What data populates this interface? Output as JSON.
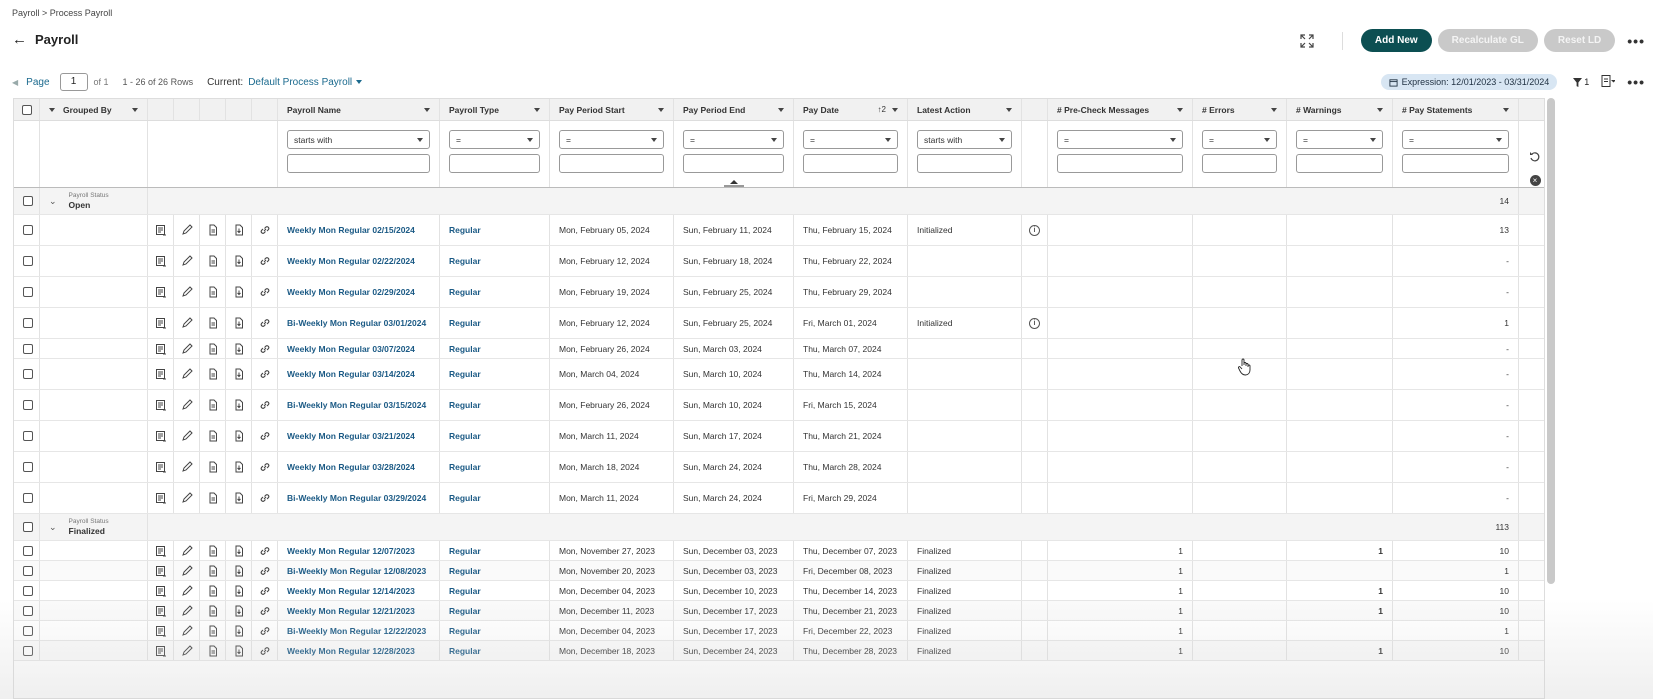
{
  "breadcrumb": "Payroll > Process Payroll",
  "page_title": "Payroll",
  "actions": {
    "add_new": "Add New",
    "recalculate": "Recalculate GL",
    "reset": "Reset LD",
    "more": "•••"
  },
  "pager": {
    "page_label": "Page",
    "page_value": "1",
    "of_text": "of 1",
    "rows_text": "1 - 26 of 26 Rows",
    "current_label": "Current:",
    "current_value": "Default Process Payroll",
    "expression": "Expression: 12/01/2023 - 03/31/2024",
    "filter_count": "1"
  },
  "columns": {
    "grouped_by": "Grouped By",
    "payroll_name": "Payroll Name",
    "payroll_type": "Payroll Type",
    "pay_period_start": "Pay Period Start",
    "pay_period_end": "Pay Period End",
    "pay_date": "Pay Date",
    "pay_date_sort": "2",
    "latest_action": "Latest Action",
    "pre_check": "# Pre-Check Messages",
    "errors": "# Errors",
    "warnings": "# Warnings",
    "pay_statements": "# Pay Statements"
  },
  "filters": {
    "starts_with": "starts with",
    "equals": "="
  },
  "groups": [
    {
      "status_label": "Payroll Status",
      "status": "Open",
      "count": "14",
      "rows": [
        {
          "name": "Weekly Mon Regular 02/15/2024",
          "type": "Regular",
          "start": "Mon, February 05, 2024",
          "end": "Sun, February 11, 2024",
          "paydate": "Thu, February 15, 2024",
          "action": "Initialized",
          "info": "i",
          "pre": "",
          "err": "",
          "warn": "",
          "stmt": "13"
        },
        {
          "name": "Weekly Mon Regular 02/22/2024",
          "type": "Regular",
          "start": "Mon, February 12, 2024",
          "end": "Sun, February 18, 2024",
          "paydate": "Thu, February 22, 2024",
          "action": "",
          "info": "",
          "pre": "",
          "err": "",
          "warn": "",
          "stmt": "-"
        },
        {
          "name": "Weekly Mon Regular 02/29/2024",
          "type": "Regular",
          "start": "Mon, February 19, 2024",
          "end": "Sun, February 25, 2024",
          "paydate": "Thu, February 29, 2024",
          "action": "",
          "info": "",
          "pre": "",
          "err": "",
          "warn": "",
          "stmt": "-"
        },
        {
          "name": "Bi-Weekly Mon Regular 03/01/2024",
          "type": "Regular",
          "start": "Mon, February 12, 2024",
          "end": "Sun, February 25, 2024",
          "paydate": "Fri, March 01, 2024",
          "action": "Initialized",
          "info": "i",
          "pre": "",
          "err": "",
          "warn": "",
          "stmt": "1"
        },
        {
          "name": "Weekly Mon Regular 03/07/2024",
          "type": "Regular",
          "start": "Mon, February 26, 2024",
          "end": "Sun, March 03, 2024",
          "paydate": "Thu, March 07, 2024",
          "action": "",
          "info": "",
          "pre": "",
          "err": "",
          "warn": "",
          "stmt": "-"
        },
        {
          "name": "Weekly Mon Regular 03/14/2024",
          "type": "Regular",
          "start": "Mon, March 04, 2024",
          "end": "Sun, March 10, 2024",
          "paydate": "Thu, March 14, 2024",
          "action": "",
          "info": "",
          "pre": "",
          "err": "",
          "warn": "",
          "stmt": "-"
        },
        {
          "name": "Bi-Weekly Mon Regular 03/15/2024",
          "type": "Regular",
          "start": "Mon, February 26, 2024",
          "end": "Sun, March 10, 2024",
          "paydate": "Fri, March 15, 2024",
          "action": "",
          "info": "",
          "pre": "",
          "err": "",
          "warn": "",
          "stmt": "-"
        },
        {
          "name": "Weekly Mon Regular 03/21/2024",
          "type": "Regular",
          "start": "Mon, March 11, 2024",
          "end": "Sun, March 17, 2024",
          "paydate": "Thu, March 21, 2024",
          "action": "",
          "info": "",
          "pre": "",
          "err": "",
          "warn": "",
          "stmt": "-"
        },
        {
          "name": "Weekly Mon Regular 03/28/2024",
          "type": "Regular",
          "start": "Mon, March 18, 2024",
          "end": "Sun, March 24, 2024",
          "paydate": "Thu, March 28, 2024",
          "action": "",
          "info": "",
          "pre": "",
          "err": "",
          "warn": "",
          "stmt": "-"
        },
        {
          "name": "Bi-Weekly Mon Regular 03/29/2024",
          "type": "Regular",
          "start": "Mon, March 11, 2024",
          "end": "Sun, March 24, 2024",
          "paydate": "Fri, March 29, 2024",
          "action": "",
          "info": "",
          "pre": "",
          "err": "",
          "warn": "",
          "stmt": "-"
        }
      ]
    },
    {
      "status_label": "Payroll Status",
      "status": "Finalized",
      "count": "113",
      "rows": [
        {
          "name": "Weekly Mon Regular 12/07/2023",
          "type": "Regular",
          "start": "Mon, November 27, 2023",
          "end": "Sun, December 03, 2023",
          "paydate": "Thu, December 07, 2023",
          "action": "Finalized",
          "info": "",
          "pre": "1",
          "err": "",
          "warn": "1",
          "stmt": "10"
        },
        {
          "name": "Bi-Weekly Mon Regular 12/08/2023",
          "type": "Regular",
          "start": "Mon, November 20, 2023",
          "end": "Sun, December 03, 2023",
          "paydate": "Fri, December 08, 2023",
          "action": "Finalized",
          "info": "",
          "pre": "1",
          "err": "",
          "warn": "",
          "stmt": "1"
        },
        {
          "name": "Weekly Mon Regular 12/14/2023",
          "type": "Regular",
          "start": "Mon, December 04, 2023",
          "end": "Sun, December 10, 2023",
          "paydate": "Thu, December 14, 2023",
          "action": "Finalized",
          "info": "",
          "pre": "1",
          "err": "",
          "warn": "1",
          "stmt": "10"
        },
        {
          "name": "Weekly Mon Regular 12/21/2023",
          "type": "Regular",
          "start": "Mon, December 11, 2023",
          "end": "Sun, December 17, 2023",
          "paydate": "Thu, December 21, 2023",
          "action": "Finalized",
          "info": "",
          "pre": "1",
          "err": "",
          "warn": "1",
          "stmt": "10"
        },
        {
          "name": "Bi-Weekly Mon Regular 12/22/2023",
          "type": "Regular",
          "start": "Mon, December 04, 2023",
          "end": "Sun, December 17, 2023",
          "paydate": "Fri, December 22, 2023",
          "action": "Finalized",
          "info": "",
          "pre": "1",
          "err": "",
          "warn": "",
          "stmt": "1"
        },
        {
          "name": "Weekly Mon Regular 12/28/2023",
          "type": "Regular",
          "start": "Mon, December 18, 2023",
          "end": "Sun, December 24, 2023",
          "paydate": "Thu, December 28, 2023",
          "action": "Finalized",
          "info": "",
          "pre": "1",
          "err": "",
          "warn": "1",
          "stmt": "10"
        }
      ]
    }
  ]
}
